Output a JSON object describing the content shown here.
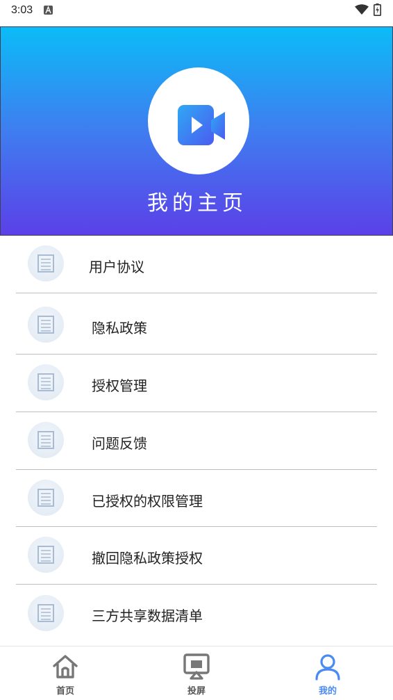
{
  "status_bar": {
    "time": "3:03"
  },
  "header": {
    "title": "我的主页"
  },
  "menu": {
    "items": [
      {
        "label": "用户协议"
      },
      {
        "label": "隐私政策"
      },
      {
        "label": "授权管理"
      },
      {
        "label": "问题反馈"
      },
      {
        "label": "已授权的权限管理"
      },
      {
        "label": "撤回隐私政策授权"
      },
      {
        "label": "三方共享数据清单"
      }
    ]
  },
  "bottom_nav": {
    "items": [
      {
        "label": "首页",
        "icon": "home-icon"
      },
      {
        "label": "投屏",
        "icon": "screen-cast-icon"
      },
      {
        "label": "我的",
        "icon": "profile-icon",
        "active": true
      }
    ]
  },
  "colors": {
    "banner_top": "#0bbcf7",
    "banner_bottom": "#5b40e8",
    "active_nav": "#4a8af4"
  }
}
